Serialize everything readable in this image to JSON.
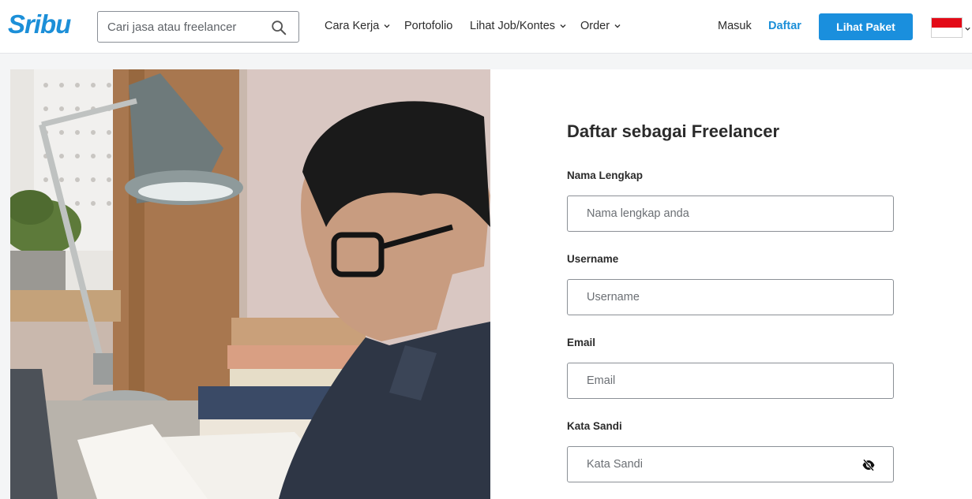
{
  "header": {
    "logo_text": "Sribu",
    "search_placeholder": "Cari jasa atau freelancer",
    "nav": [
      {
        "label": "Cara Kerja",
        "has_dropdown": true
      },
      {
        "label": "Portofolio",
        "has_dropdown": false
      },
      {
        "label": "Lihat Job/Kontes",
        "has_dropdown": true
      },
      {
        "label": "Order",
        "has_dropdown": true
      }
    ],
    "login_label": "Masuk",
    "register_label": "Daftar",
    "cta_label": "Lihat Paket",
    "language_flag": "indonesia-flag-icon"
  },
  "form": {
    "title": "Daftar sebagai Freelancer",
    "fields": [
      {
        "label": "Nama Lengkap",
        "placeholder": "Nama lengkap anda"
      },
      {
        "label": "Username",
        "placeholder": "Username"
      },
      {
        "label": "Email",
        "placeholder": "Email"
      },
      {
        "label": "Kata Sandi",
        "placeholder": "Kata Sandi"
      }
    ]
  },
  "colors": {
    "brand": "#1c8fd8",
    "cta": "#1a8fdd",
    "page_bg": "#f4f5f6"
  }
}
